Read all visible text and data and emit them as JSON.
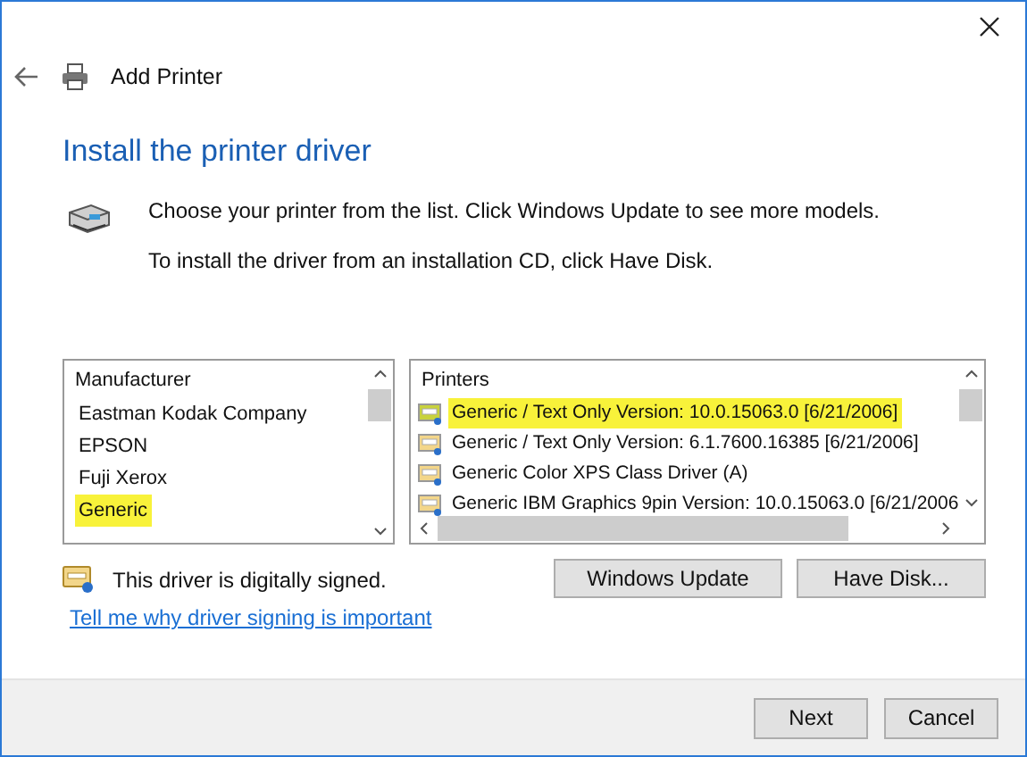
{
  "window": {
    "title": "Add Printer"
  },
  "heading": "Install the printer driver",
  "instructions": [
    "Choose your printer from the list. Click Windows Update to see more models.",
    "To install the driver from an installation CD, click Have Disk."
  ],
  "manufacturers": {
    "header": "Manufacturer",
    "items": [
      {
        "label": "Eastman Kodak Company",
        "selected": false
      },
      {
        "label": "EPSON",
        "selected": false
      },
      {
        "label": "Fuji Xerox",
        "selected": false
      },
      {
        "label": "Generic",
        "selected": true
      }
    ]
  },
  "printers": {
    "header": "Printers",
    "items": [
      {
        "label": "Generic / Text Only Version: 10.0.15063.0 [6/21/2006]",
        "selected": true
      },
      {
        "label": "Generic / Text Only Version: 6.1.7600.16385 [6/21/2006]",
        "selected": false
      },
      {
        "label": "Generic Color XPS Class Driver (A)",
        "selected": false
      },
      {
        "label": "Generic IBM Graphics 9pin Version: 10.0.15063.0 [6/21/2006",
        "selected": false
      }
    ]
  },
  "signature": {
    "text": "This driver is digitally signed.",
    "link": "Tell me why driver signing is important"
  },
  "buttons": [
    "Windows Update",
    "Have Disk..."
  ],
  "footer_buttons": [
    "Next",
    "Cancel"
  ]
}
